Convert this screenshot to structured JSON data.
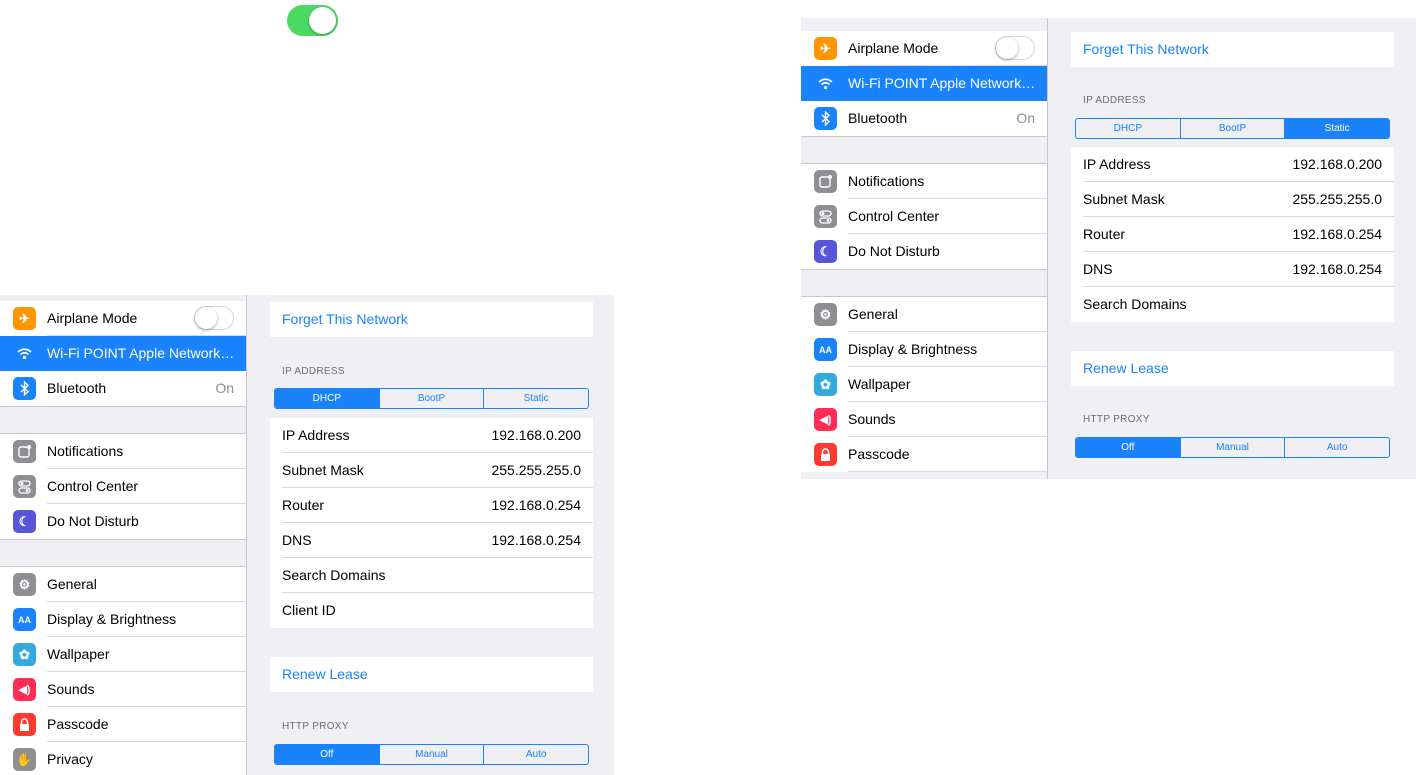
{
  "colors": {
    "accent": "#1a82fb",
    "toggle_on": "#4cd964",
    "background": "#efeff4"
  },
  "sidebar": {
    "airplane": {
      "label": "Airplane Mode",
      "icon": "airplane-icon",
      "color": "#ff9500"
    },
    "wifi": {
      "label": "Wi-Fi  POINT Apple Network…",
      "icon": "wifi-icon",
      "color": "#1a82fb"
    },
    "bluetooth": {
      "label": "Bluetooth",
      "value": "On",
      "icon": "bluetooth-icon",
      "color": "#1a82fb"
    },
    "notifications": {
      "label": "Notifications",
      "icon": "notifications-icon",
      "color": "#8e8e93"
    },
    "control_center": {
      "label": "Control Center",
      "icon": "control-center-icon",
      "color": "#8e8e93"
    },
    "dnd": {
      "label": "Do Not Disturb",
      "icon": "moon-icon",
      "color": "#5856d6"
    },
    "general": {
      "label": "General",
      "icon": "gear-icon",
      "color": "#8e8e93"
    },
    "display": {
      "label": "Display & Brightness",
      "icon": "display-icon",
      "icon_text": "AA",
      "color": "#1a82fb"
    },
    "wallpaper": {
      "label": "Wallpaper",
      "icon": "wallpaper-icon",
      "color": "#34aadc"
    },
    "sounds": {
      "label": "Sounds",
      "icon": "speaker-icon",
      "color": "#ff2d55"
    },
    "passcode": {
      "label": "Passcode",
      "icon": "lock-icon",
      "color": "#ff3b30"
    },
    "privacy": {
      "label": "Privacy",
      "icon": "hand-icon",
      "color": "#8e8e93"
    }
  },
  "detail": {
    "forget": "Forget This Network",
    "ip_header": "IP ADDRESS",
    "ip_modes": [
      "DHCP",
      "BootP",
      "Static"
    ],
    "fields": {
      "ip": {
        "label": "IP Address",
        "value": "192.168.0.200"
      },
      "subnet": {
        "label": "Subnet Mask",
        "value": "255.255.255.0"
      },
      "router": {
        "label": "Router",
        "value": "192.168.0.254"
      },
      "dns": {
        "label": "DNS",
        "value": "192.168.0.254"
      },
      "search": {
        "label": "Search Domains",
        "value": ""
      },
      "client": {
        "label": "Client ID",
        "value": ""
      }
    },
    "renew": "Renew Lease",
    "proxy_header": "HTTP PROXY",
    "proxy_modes": [
      "Off",
      "Manual",
      "Auto"
    ]
  }
}
